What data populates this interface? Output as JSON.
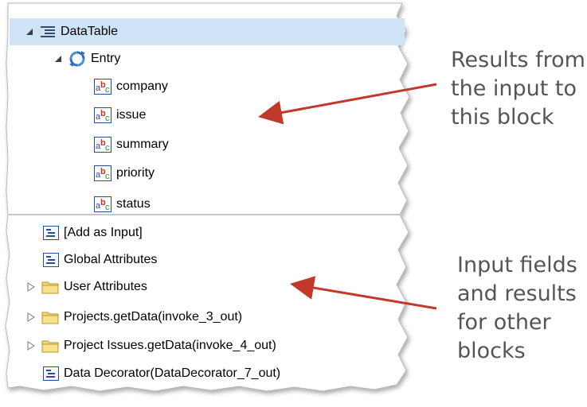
{
  "tree_top": {
    "items": [
      {
        "label": "DataTable",
        "level": 0,
        "icon": "datatable-icon",
        "expanded": true
      },
      {
        "label": "Entry",
        "level": 1,
        "icon": "entry-cycle-icon",
        "expanded": true
      },
      {
        "label": "company",
        "level": 2,
        "icon": "string-field-icon"
      },
      {
        "label": "issue",
        "level": 2,
        "icon": "string-field-icon"
      },
      {
        "label": "summary",
        "level": 2,
        "icon": "string-field-icon"
      },
      {
        "label": "priority",
        "level": 2,
        "icon": "string-field-icon"
      },
      {
        "label": "status",
        "level": 2,
        "icon": "string-field-icon"
      }
    ]
  },
  "tree_bottom": {
    "items": [
      {
        "label": "[Add as Input]",
        "icon": "attribute-list-icon",
        "expandable": false
      },
      {
        "label": "Global Attributes",
        "icon": "attribute-list-icon",
        "expandable": false
      },
      {
        "label": "User Attributes",
        "icon": "folder-icon",
        "expandable": true
      },
      {
        "label": "Projects.getData(invoke_3_out)",
        "icon": "folder-icon",
        "expandable": true
      },
      {
        "label": "Project Issues.getData(invoke_4_out)",
        "icon": "folder-icon",
        "expandable": true
      },
      {
        "label": "Data Decorator(DataDecorator_7_out)",
        "icon": "attribute-list-icon",
        "expandable": false
      }
    ]
  },
  "annotations": {
    "top": [
      "Results from",
      "the input to",
      "this block"
    ],
    "bottom": [
      "Input fields",
      "and results",
      "for other",
      "blocks"
    ]
  },
  "colors": {
    "selection": "#cfe3f7",
    "arrow": "#c0392b",
    "annotation_text": "#555555",
    "folder_fill": "#f5d77a"
  }
}
